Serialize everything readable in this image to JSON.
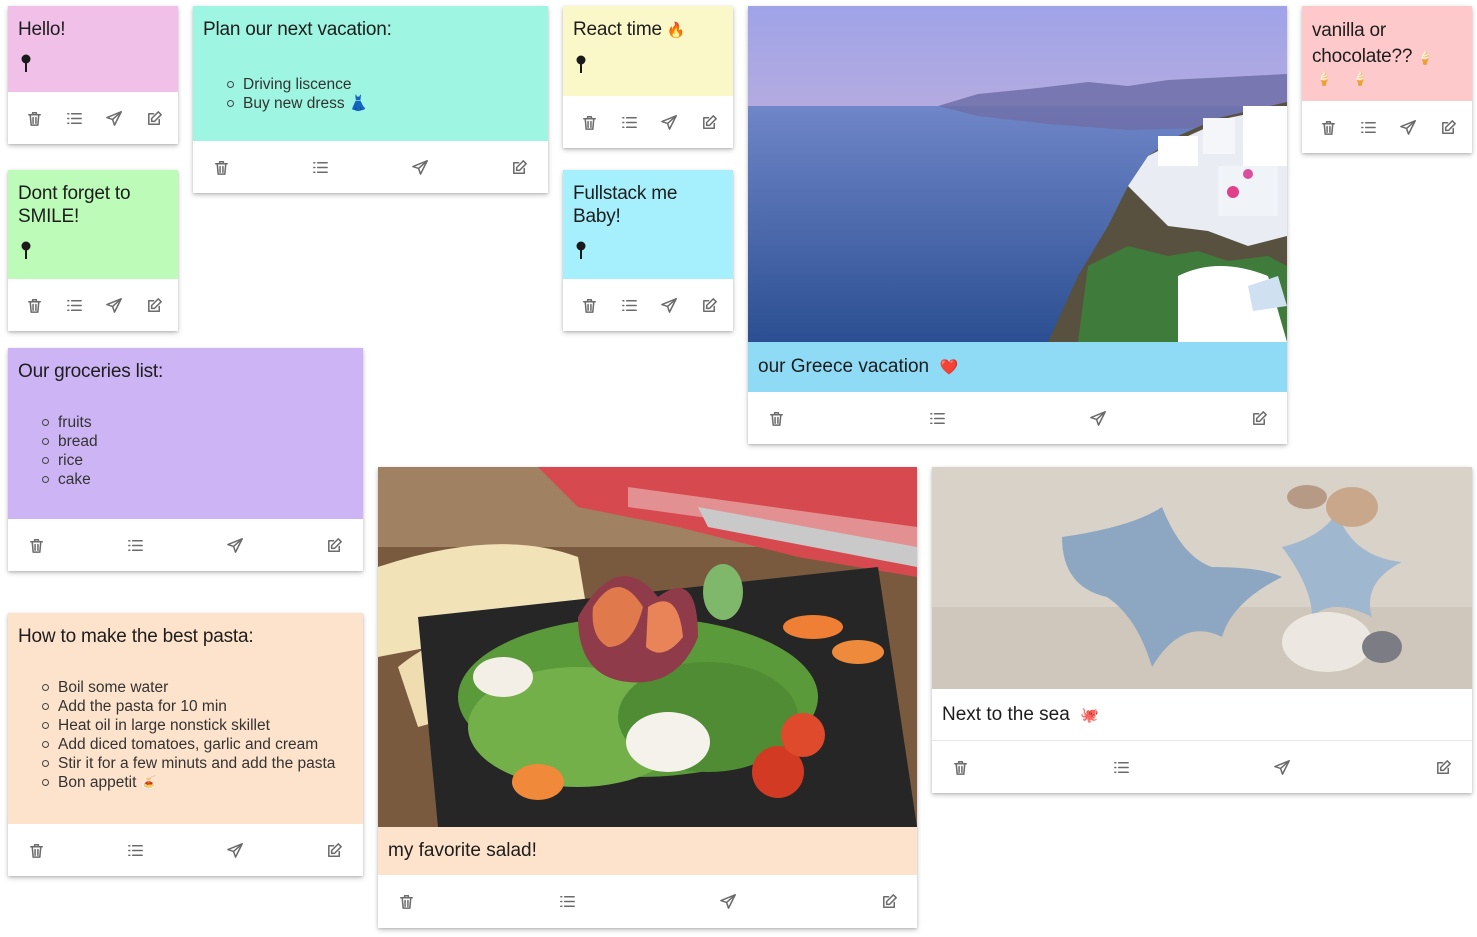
{
  "notes": {
    "hello": {
      "title": "Hello!",
      "color": "#f0c0e8"
    },
    "vacation": {
      "title": "Plan our next vacation:",
      "color": "#9ef5e2",
      "items": [
        "Driving liscence",
        "Buy new dress"
      ],
      "item_emoji": [
        "",
        "👗"
      ]
    },
    "react": {
      "title": "React time",
      "title_emoji": "🔥",
      "color": "#faf7c8"
    },
    "vanilla": {
      "title": "vanilla or chocolate??",
      "title_emoji": "🍦",
      "extra_emoji": "🍦 🍦",
      "color": "#fdc9cb"
    },
    "smile": {
      "title": "Dont forget to SMILE!",
      "color": "#bcfbb8"
    },
    "fullstack": {
      "title": "Fullstack me Baby!",
      "color": "#a5f0fc"
    },
    "greece": {
      "caption": "our Greece vacation",
      "caption_emoji": "❤️",
      "color": "#8fdaf5"
    },
    "groceries": {
      "title": "Our groceries list:",
      "color": "#cdb5f5",
      "items": [
        "fruits",
        "bread",
        "rice",
        "cake"
      ]
    },
    "pasta": {
      "title": "How to make the best pasta:",
      "color": "#fde3cb",
      "items": [
        "Boil some water",
        "Add the pasta for 10 min",
        "Heat oil in large nonstick skillet",
        "Add diced tomatoes, garlic and cream",
        "Stir it for a few minuts and add the pasta",
        "Bon appetit"
      ],
      "last_emoji": "🍝"
    },
    "salad": {
      "caption": "my favorite salad!",
      "color": "#fde3cb"
    },
    "sea": {
      "caption": "Next to the sea",
      "caption_emoji": "🐙",
      "color": "#ffffff"
    }
  },
  "tools": {
    "icons": [
      "trash-icon",
      "list-icon",
      "send-icon",
      "edit-icon"
    ],
    "color": "#6b6b6b"
  }
}
